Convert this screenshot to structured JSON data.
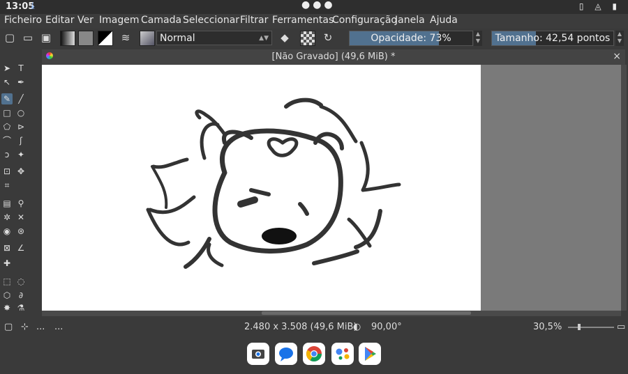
{
  "status_bar": {
    "time": "13:05",
    "download_icon": "download-arrow-icon",
    "dots": "●●●",
    "system_icons": "vibrate wifi battery"
  },
  "menu": [
    "Ficheiro",
    "Editar",
    "Ver",
    "Imagem",
    "Camada",
    "Seleccionar",
    "Filtrar",
    "Ferramentas",
    "Configuração",
    "Janela",
    "Ajuda"
  ],
  "toolbar": {
    "blend_mode": "Normal",
    "opacity_label": "Opacidade: 73%",
    "opacity_value": 0.73,
    "size_label": "Tamanho: 42,54 pontos"
  },
  "document": {
    "title": "[Não Gravado]  (49,6 MiB) *",
    "close": "×"
  },
  "statusbar": {
    "left_dots_1": "...",
    "left_dots_2": "...",
    "dimensions": "2.480 x 3.508 (49,6 MiB)",
    "rotation": "90,00°",
    "zoom": "30,5%"
  },
  "dock_apps": [
    "camera",
    "messages",
    "chrome",
    "assistant",
    "play-store"
  ],
  "colors": {
    "accent": "#51718f",
    "background": "#3a3a3a",
    "canvas_bg": "#7a7a7a",
    "paper": "#ffffff"
  }
}
